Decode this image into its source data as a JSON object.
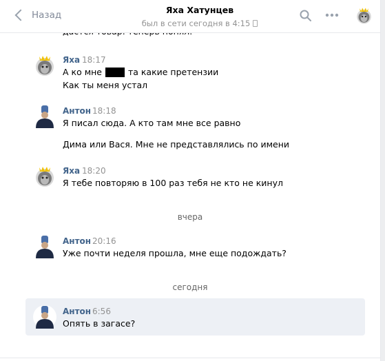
{
  "header": {
    "back_label": "Назад",
    "title": "Яха Хатунцев",
    "status": "был в сети сегодня в 4:15",
    "icons": [
      "search-icon",
      "more-icon",
      "phone-icon",
      "avatar-lion"
    ]
  },
  "history_cut_text": "дастся товар. теперь понял.",
  "dates": {
    "yesterday": "вчера",
    "today": "сегодня"
  },
  "messages": [
    {
      "author": "Яха",
      "time": "18:17",
      "avatar": "lion-crown",
      "lines": [
        "А ко мне ",
        " та какие претензии",
        "Как ты меня устал"
      ]
    },
    {
      "author": "Антон",
      "time": "18:18",
      "avatar": "blue-man",
      "lines": [
        "Я писал сюда. А кто там мне все равно",
        "Дима или Вася. Мне не представлялись по имени"
      ]
    },
    {
      "author": "Яха",
      "time": "18:20",
      "avatar": "lion-crown",
      "lines": [
        "Я тебе повторяю в 100 раз тебя не кто не кинул"
      ]
    },
    {
      "author": "Антон",
      "time": "20:16",
      "avatar": "blue-man",
      "lines": [
        "Уже почти неделя прошла, мне еще подождать?"
      ]
    },
    {
      "author": "Антон",
      "time": "6:56",
      "avatar": "blue-man",
      "lines": [
        "Опять в загасе?"
      ]
    }
  ],
  "colors": {
    "author": "#42648b",
    "time": "#939393",
    "highlight": "#edf0f5",
    "background": "#edeef0"
  }
}
